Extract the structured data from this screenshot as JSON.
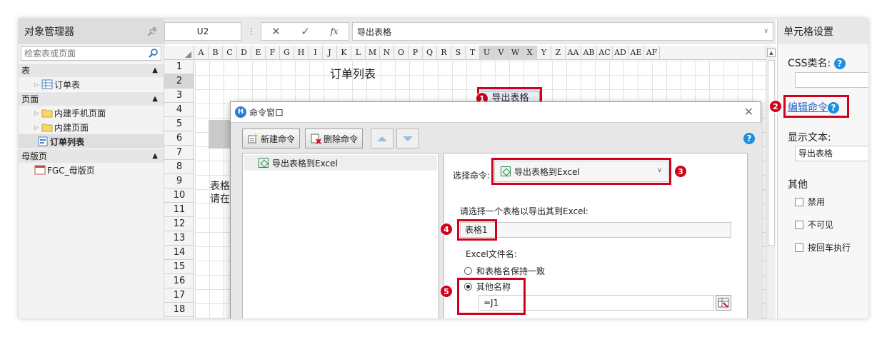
{
  "left_panel": {
    "title": "对象管理器",
    "search_placeholder": "检索表或页面",
    "sections": {
      "tables": "表",
      "pages": "页面",
      "master": "母版页"
    },
    "items": {
      "order_table": "订单表",
      "builtin_mobile": "内建手机页面",
      "builtin_pages": "内建页面",
      "order_list": "订单列表",
      "fgc_master": "FGC_母版页"
    }
  },
  "formula_bar": {
    "cell_ref": "U2",
    "fx": "fx",
    "value": "导出表格"
  },
  "sheet": {
    "columns": [
      "A",
      "B",
      "C",
      "D",
      "E",
      "F",
      "G",
      "H",
      "I",
      "J",
      "K",
      "L",
      "M",
      "N",
      "O",
      "P",
      "Q",
      "R",
      "S",
      "T",
      "U",
      "V",
      "W",
      "X",
      "Y",
      "Z",
      "AA",
      "AB",
      "AC",
      "AD",
      "AE",
      "AF"
    ],
    "rows": [
      "1",
      "2",
      "3",
      "4",
      "5",
      "6",
      "7",
      "8",
      "9",
      "10",
      "11",
      "12",
      "13",
      "14",
      "15",
      "16",
      "17",
      "18"
    ],
    "title_text": "订单列表",
    "button_text": "导出表格",
    "bg_text_line1": "表格",
    "bg_text_line2": "请在"
  },
  "right_panel": {
    "title": "单元格设置",
    "css_label": "CSS类名:",
    "edit_command": "编辑命令",
    "display_text_label": "显示文本:",
    "display_text_value": "导出表格",
    "other_label": "其他",
    "checkboxes": [
      "禁用",
      "不可见",
      "按回车执行"
    ]
  },
  "dialog": {
    "title": "命令窗口",
    "new_command": "新建命令",
    "delete_command": "删除命令",
    "command_list": [
      "导出表格到Excel"
    ],
    "select_command_label": "选择命令:",
    "selected_command": "导出表格到Excel",
    "table_prompt": "请选择一个表格以导出其到Excel:",
    "table_value": "表格1",
    "filename_label": "Excel文件名:",
    "radio_same": "和表格名保持一致",
    "radio_other": "其他名称",
    "filename_value": "=J1"
  },
  "annotations": [
    "1",
    "2",
    "3",
    "4",
    "5"
  ],
  "colors": {
    "annotation_red": "#d0021b",
    "link_blue": "#2a63c8",
    "help_blue": "#1c8fe0"
  }
}
